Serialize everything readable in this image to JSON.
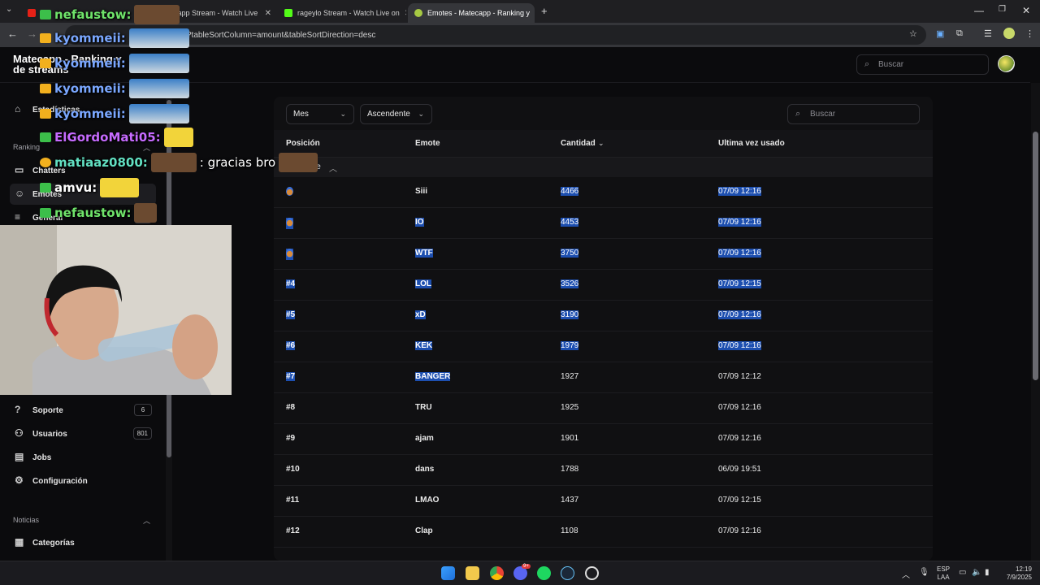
{
  "browser": {
    "tabs": [
      {
        "label": "",
        "active": false
      },
      {
        "label": "matecapp Stream - Watch Live",
        "active": false
      },
      {
        "label": "rageylo Stream - Watch Live on",
        "active": false
      },
      {
        "label": "Emotes - Matecapp - Ranking y",
        "active": true
      }
    ],
    "url": "?tableSortColumn=amount&tableSortDirection=desc"
  },
  "app": {
    "title": "Matecapp - Ranking y de streams",
    "search_placeholder": "Buscar"
  },
  "sidebar": {
    "items_top": [
      {
        "label": "Estadísticas",
        "icon": "home-icon"
      }
    ],
    "section_ranking": "Ranking",
    "ranking_items": [
      {
        "label": "Chatters",
        "icon": "chat-icon"
      },
      {
        "label": "Emotes",
        "icon": "smile-icon",
        "active": true
      },
      {
        "label": "General",
        "icon": "list-icon",
        "badge": "1"
      }
    ],
    "items_bottom": [
      {
        "label": "Soporte",
        "icon": "help-icon",
        "badge": "6"
      },
      {
        "label": "Usuarios",
        "icon": "users-icon",
        "badge": "801"
      },
      {
        "label": "Jobs",
        "icon": "jobs-icon"
      },
      {
        "label": "Configuración",
        "icon": "gear-icon"
      }
    ],
    "section_news": "Noticias",
    "news_items": [
      {
        "label": "Categorías",
        "icon": "grid-icon"
      }
    ]
  },
  "filters": {
    "period": "Mes",
    "order": "Ascendente",
    "search_placeholder": "Buscar"
  },
  "table": {
    "headers": [
      "Posición",
      "Emote",
      "Cantidad",
      "Ultima vez usado"
    ],
    "group_label": "mbre",
    "rows": [
      {
        "pos": "",
        "medal": true,
        "emote": "Siii",
        "amount": "4466",
        "last": "07/09 12:16",
        "hl": [
          false,
          false,
          true,
          true
        ]
      },
      {
        "pos": "",
        "medal": true,
        "emote": "IO",
        "amount": "4453",
        "last": "07/09 12:16",
        "hl": [
          true,
          true,
          true,
          true
        ]
      },
      {
        "pos": "",
        "medal": true,
        "emote": "WTF",
        "amount": "3750",
        "last": "07/09 12:16",
        "hl": [
          true,
          true,
          true,
          true
        ]
      },
      {
        "pos": "#4",
        "emote": "LOL",
        "amount": "3526",
        "last": "07/09 12:15",
        "hl": [
          true,
          true,
          true,
          true
        ]
      },
      {
        "pos": "#5",
        "emote": "xD",
        "amount": "3190",
        "last": "07/09 12:16",
        "hl": [
          true,
          true,
          true,
          true
        ]
      },
      {
        "pos": "#6",
        "emote": "KEK",
        "amount": "1979",
        "last": "07/09 12:16",
        "hl": [
          true,
          true,
          true,
          true
        ]
      },
      {
        "pos": "#7",
        "emote": "BANGER",
        "amount": "1927",
        "last": "07/09 12:12",
        "hl": [
          true,
          true,
          false,
          false
        ]
      },
      {
        "pos": "#8",
        "emote": "TRU",
        "amount": "1925",
        "last": "07/09 12:16",
        "hl": [
          false,
          false,
          false,
          false
        ]
      },
      {
        "pos": "#9",
        "emote": "ajam",
        "amount": "1901",
        "last": "07/09 12:16",
        "hl": [
          false,
          false,
          false,
          false
        ]
      },
      {
        "pos": "#10",
        "emote": "dans",
        "amount": "1788",
        "last": "06/09 19:51",
        "hl": [
          false,
          false,
          false,
          false
        ]
      },
      {
        "pos": "#11",
        "emote": "LMAO",
        "amount": "1437",
        "last": "07/09 12:15",
        "hl": [
          false,
          false,
          false,
          false
        ]
      },
      {
        "pos": "#12",
        "emote": "Clap",
        "amount": "1108",
        "last": "07/09 12:16",
        "hl": [
          false,
          false,
          false,
          false
        ]
      }
    ]
  },
  "stream_chat": [
    {
      "user": "nefaustow:",
      "color": "#6fe36a",
      "message": ""
    },
    {
      "user": "kyommeii:",
      "color": "#7aa7ff",
      "message": ""
    },
    {
      "user": "kyommeii:",
      "color": "#7aa7ff",
      "message": ""
    },
    {
      "user": "kyommeii:",
      "color": "#7aa7ff",
      "message": ""
    },
    {
      "user": "kyommeii:",
      "color": "#7aa7ff",
      "message": ""
    },
    {
      "user": "ElGordoMati05:",
      "color": "#c66bff",
      "message": ""
    },
    {
      "user": "matiaaz0800:",
      "color": "#62e0c2",
      "message": ": gracias bro"
    },
    {
      "user": "amvu:",
      "color": "#ffffff",
      "message": ""
    },
    {
      "user": "nefaustow:",
      "color": "#6fe36a",
      "message": ""
    }
  ],
  "taskbar": {
    "lang_top": "ESP",
    "lang_bottom": "LAA",
    "time": "12:19",
    "date": "7/9/2025",
    "discord_badge": "9+"
  }
}
